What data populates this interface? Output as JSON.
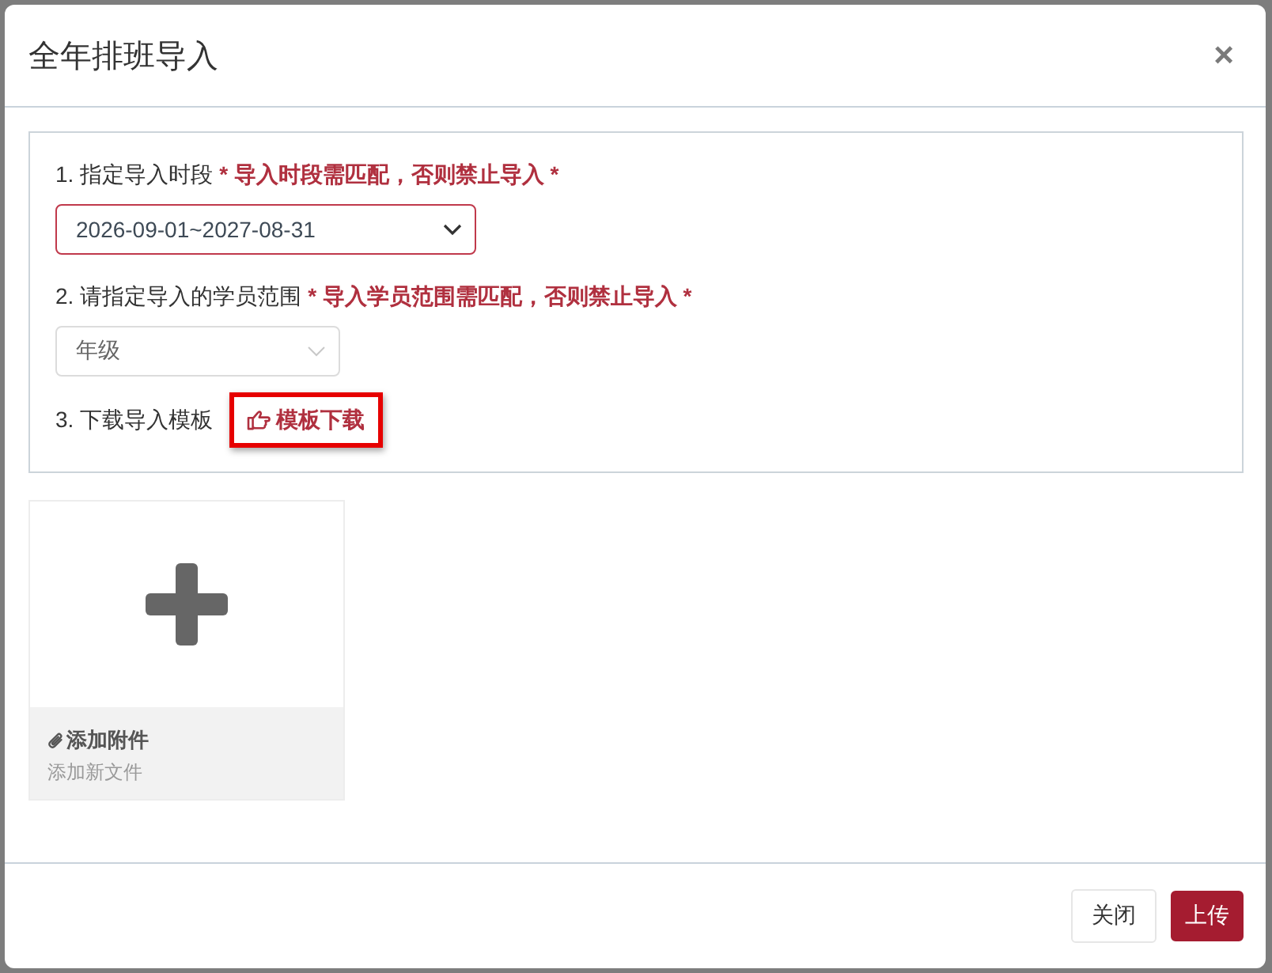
{
  "dialog": {
    "title": "全年排班导入",
    "close": "×"
  },
  "steps": [
    {
      "kind": "select",
      "label": "1. 指定导入时段",
      "note": "* 导入时段需匹配，否则禁止导入 *",
      "select": {
        "value": "2026-09-01~2027-08-31",
        "disabled": false
      }
    },
    {
      "kind": "select",
      "label": "2. 请指定导入的学员范围",
      "note": "* 导入学员范围需匹配，否则禁止导入 *",
      "select": {
        "value": "年级",
        "disabled": true
      }
    },
    {
      "kind": "download",
      "label": "3. 下载导入模板",
      "link": {
        "text": "模板下载",
        "highlighted": true
      }
    }
  ],
  "upload": {
    "title": "添加附件",
    "subtitle": "添加新文件"
  },
  "buttons": [
    {
      "kind": "secondary",
      "label": "关闭"
    },
    {
      "kind": "primary",
      "label": "上传"
    }
  ]
}
